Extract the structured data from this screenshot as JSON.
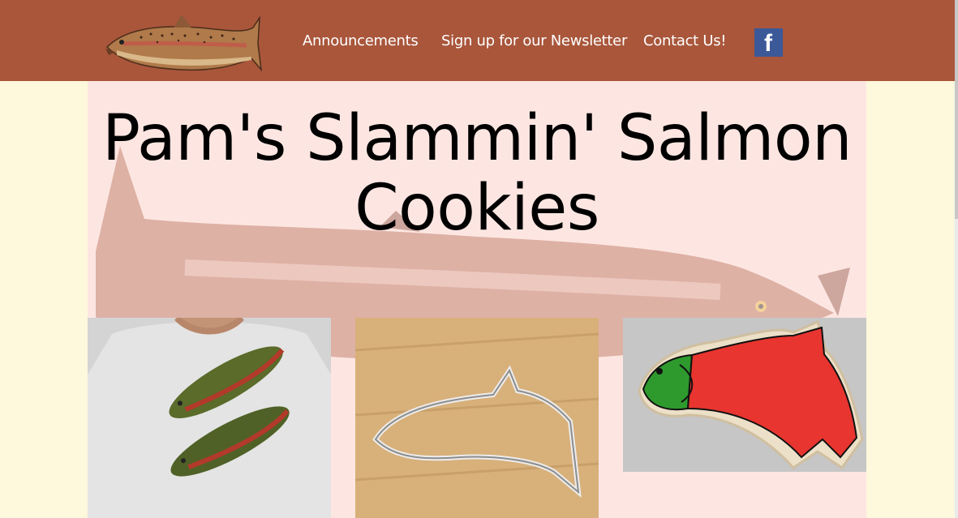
{
  "header": {
    "logo_icon": "salmon-logo-icon",
    "nav": [
      {
        "label": "Announcements"
      },
      {
        "label": "Sign up for our Newsletter"
      },
      {
        "label": "Contact Us!"
      }
    ],
    "social_icon": "facebook-icon",
    "social_letter": "f"
  },
  "main": {
    "title": "Pam's Slammin' Salmon Cookies",
    "products": [
      {
        "image": "salmon-tshirt-image"
      },
      {
        "image": "salmon-cookie-cutter-image"
      },
      {
        "image": "salmon-cookie-image"
      }
    ]
  },
  "colors": {
    "header_bg": "#a9563b",
    "page_bg": "#fef8dc",
    "panel_bg": "#fde6e2",
    "facebook_blue": "#3b5998"
  }
}
